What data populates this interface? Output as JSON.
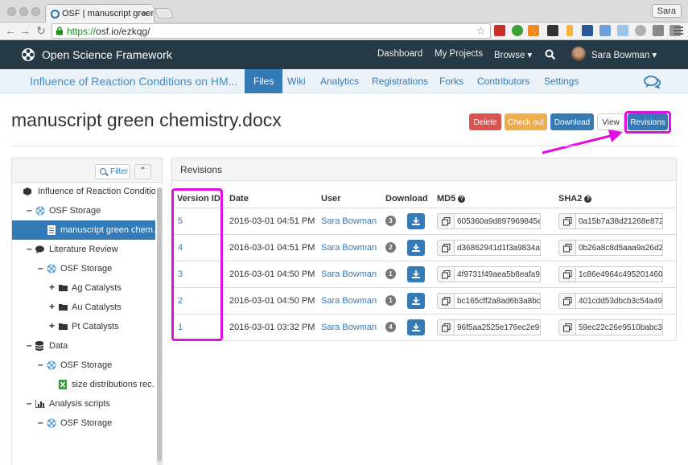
{
  "browser": {
    "tab_title": "OSF | manuscript green che",
    "user": "Sara",
    "url_scheme": "https://",
    "url_rest": "osf.io/ezkqg/"
  },
  "osf_nav": {
    "brand": "Open Science Framework",
    "links": [
      "Dashboard",
      "My Projects",
      "Browse ▾"
    ],
    "user_name": "Sara Bowman ▾"
  },
  "project_nav": {
    "title": "Influence of Reaction Conditions on HM...",
    "tabs": [
      "Files",
      "Wiki",
      "Analytics",
      "Registrations",
      "Forks",
      "Contributors",
      "Settings"
    ],
    "active_tab": "Files"
  },
  "file": {
    "title": "manuscript green chemistry.docx",
    "buttons": {
      "delete": "Delete",
      "checkout": "Check out",
      "download": "Download",
      "view": "View",
      "revisions": "Revisions"
    }
  },
  "tree": {
    "filter_label": "Filter",
    "collapse_label": "⌃",
    "items": [
      {
        "label": "Influence of Reaction Conditio...",
        "toggle": "",
        "icon": "cube-icon",
        "depth": 0
      },
      {
        "label": "OSF Storage",
        "toggle": "–",
        "icon": "osf-storage-icon",
        "depth": 1
      },
      {
        "label": "manuscript green chem...",
        "toggle": "",
        "icon": "word-file-icon",
        "depth": 2,
        "selected": true
      },
      {
        "label": "Literature Review",
        "toggle": "–",
        "icon": "comment-icon",
        "depth": 1
      },
      {
        "label": "OSF Storage",
        "toggle": "–",
        "icon": "osf-storage-icon",
        "depth": 2
      },
      {
        "label": "Ag Catalysts",
        "toggle": "+",
        "icon": "folder-icon",
        "depth": 3
      },
      {
        "label": "Au Catalysts",
        "toggle": "+",
        "icon": "folder-icon",
        "depth": 3
      },
      {
        "label": "Pt Catalysts",
        "toggle": "+",
        "icon": "folder-icon",
        "depth": 3
      },
      {
        "label": "Data",
        "toggle": "–",
        "icon": "database-icon",
        "depth": 1
      },
      {
        "label": "OSF Storage",
        "toggle": "–",
        "icon": "osf-storage-icon",
        "depth": 2
      },
      {
        "label": "size distributions rec...",
        "toggle": "",
        "icon": "excel-file-icon",
        "depth": 3
      },
      {
        "label": "Analysis scripts",
        "toggle": "–",
        "icon": "bar-chart-icon",
        "depth": 1
      },
      {
        "label": "OSF Storage",
        "toggle": "–",
        "icon": "osf-storage-icon",
        "depth": 2
      }
    ]
  },
  "revisions": {
    "heading": "Revisions",
    "columns": [
      "Version ID",
      "Date",
      "User",
      "Download",
      "MD5",
      "SHA2"
    ],
    "rows": [
      {
        "version": "5",
        "date": "2016-03-01 04:51 PM",
        "user": "Sara Bowman",
        "downloads": "3",
        "md5": "605360a9d897969845e",
        "sha2": "0a15b7a38d21268e872"
      },
      {
        "version": "4",
        "date": "2016-03-01 04:51 PM",
        "user": "Sara Bowman",
        "downloads": "2",
        "md5": "d36862941d1f3a9834a",
        "sha2": "0b26a8c8d5aaa9a26d2"
      },
      {
        "version": "3",
        "date": "2016-03-01 04:50 PM",
        "user": "Sara Bowman",
        "downloads": "1",
        "md5": "4f9731f49aea5b8eafa9",
        "sha2": "1c86e4964c495201460"
      },
      {
        "version": "2",
        "date": "2016-03-01 04:50 PM",
        "user": "Sara Bowman",
        "downloads": "1",
        "md5": "bc165cff2a8ad6b3a8bc",
        "sha2": "401cdd53dbcb3c54a49"
      },
      {
        "version": "1",
        "date": "2016-03-01 03:32 PM",
        "user": "Sara Bowman",
        "downloads": "4",
        "md5": "96f5aa2525e176ec2e9.",
        "sha2": "59ec22c26e9510babc3"
      }
    ]
  },
  "colors": {
    "highlight": "#e010e0",
    "primary": "#337ab7",
    "nav": "#263947"
  }
}
